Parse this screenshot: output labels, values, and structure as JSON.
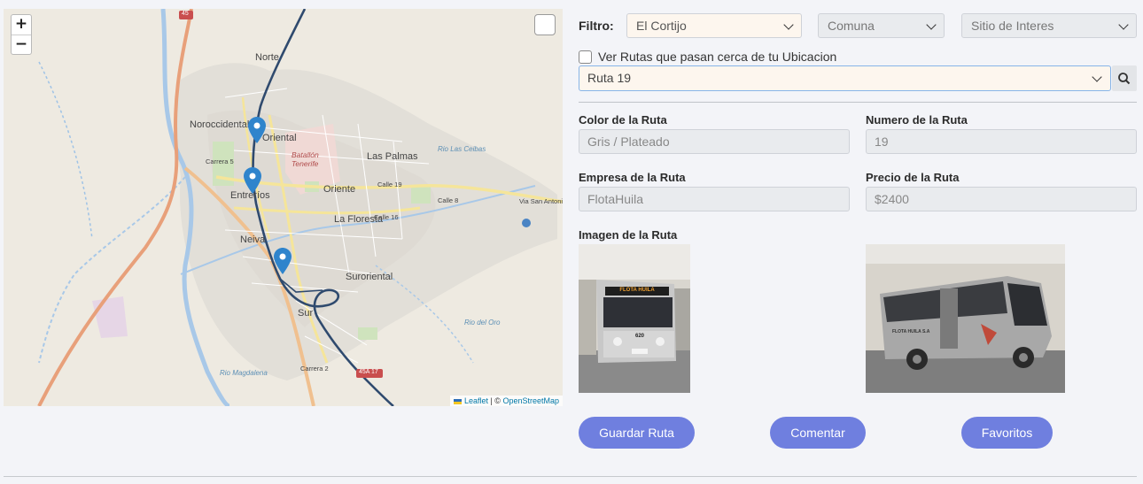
{
  "map": {
    "zoom_in": "+",
    "zoom_out": "−",
    "labels": {
      "norte": "Norte",
      "noroccidental": "Noroccidental",
      "oriental": "Oriental",
      "batallon": "Batallón\nTenerife",
      "las_palmas": "Las Palmas",
      "oriente": "Oriente",
      "entreros": "Entreríos",
      "la_floresta": "La Floresta",
      "neiva": "Neiva",
      "suroriental": "Suroriental",
      "sur": "Sur",
      "calle19": "Calle 19",
      "calle16": "Calle 16",
      "calle8": "Calle 8",
      "via_san_antonio": "Via San Antonio",
      "carrera2": "Carrera 2",
      "carrera5": "Carrera 5",
      "rio_magdalena": "Rio Magdalena",
      "rio_las_ceibas": "Rio Las Ceibas",
      "rio_del_oro": "Rio del Oro",
      "road45": "45",
      "road45a17": "45A 17"
    },
    "attribution": {
      "leaflet": "Leaflet",
      "separator": " | © ",
      "osm": "OpenStreetMap"
    }
  },
  "filter": {
    "label": "Filtro:",
    "barrio": "El Cortijo",
    "comuna": "Comuna",
    "sitio": "Sitio de Interes"
  },
  "nearby": {
    "label": "Ver Rutas que pasan cerca de tu Ubicacion",
    "checked": false
  },
  "route_select": {
    "value": "Ruta 19"
  },
  "details": {
    "color_label": "Color de la Ruta",
    "color_value": "Gris / Plateado",
    "numero_label": "Numero de la Ruta",
    "numero_value": "19",
    "empresa_label": "Empresa de la Ruta",
    "empresa_value": "FlotaHuila",
    "precio_label": "Precio de la Ruta",
    "precio_value": "$2400",
    "imagen_label": "Imagen de la Ruta"
  },
  "images": {
    "front_sign": "FLOTA HUILA",
    "front_number": "620",
    "side_sign": "FLOTA HUILA S.A"
  },
  "actions": {
    "guardar": "Guardar Ruta",
    "comentar": "Comentar",
    "favoritos": "Favoritos"
  },
  "colors": {
    "button": "#6f7fdf",
    "route_line": "#2f4a6e",
    "pin": "#2f84cc"
  },
  "icons": [
    "search-icon",
    "chevron-down-icon",
    "map-pin-icon",
    "layer-icon"
  ]
}
